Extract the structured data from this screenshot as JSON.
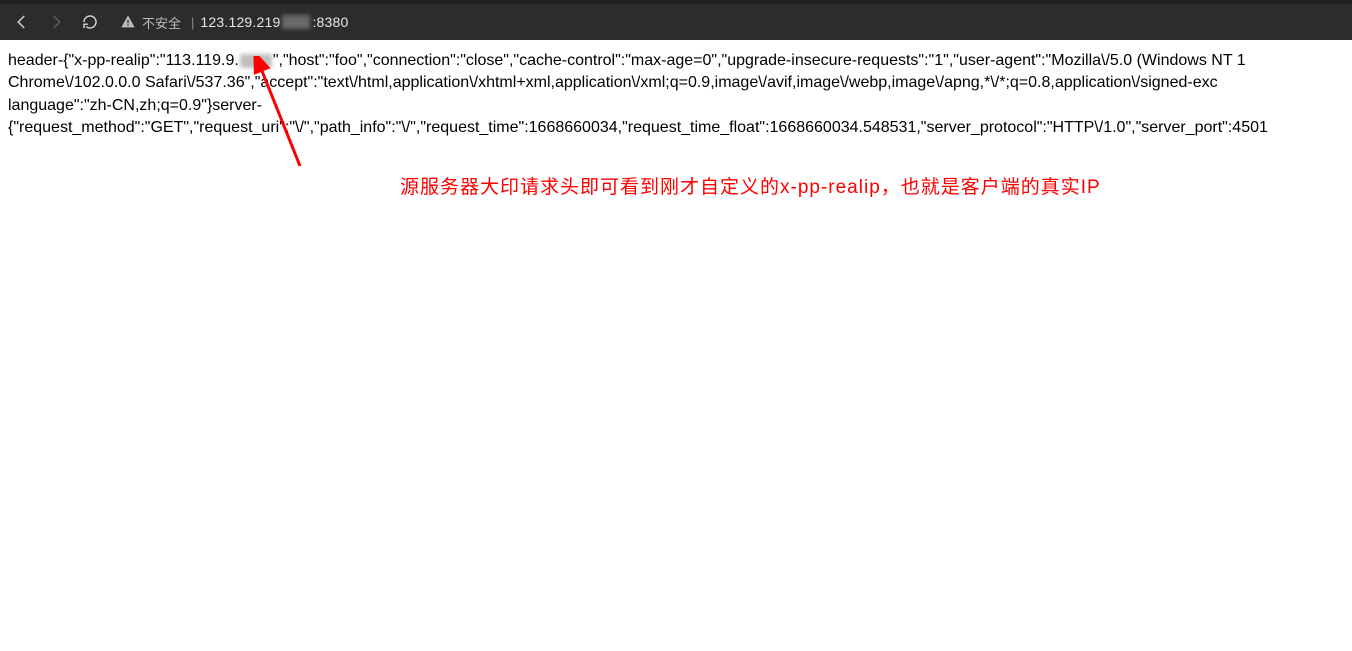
{
  "toolbar": {
    "insecure_label": "不安全",
    "url_prefix": "123.129.219",
    "url_suffix": ":8380"
  },
  "body": {
    "line1a": "header-{\"x-pp-realip\":\"113.119.9.",
    "line1b": "\",\"host\":\"foo\",\"connection\":\"close\",\"cache-control\":\"max-age=0\",\"upgrade-insecure-requests\":\"1\",\"user-agent\":\"Mozilla\\/5.0 (Windows NT 1",
    "line2": "Chrome\\/102.0.0.0 Safari\\/537.36\",\"accept\":\"text\\/html,application\\/xhtml+xml,application\\/xml;q=0.9,image\\/avif,image\\/webp,image\\/apng,*\\/*;q=0.8,application\\/signed-exc",
    "line3": "language\":\"zh-CN,zh;q=0.9\"}server-",
    "line4": "{\"request_method\":\"GET\",\"request_uri\":\"\\/\",\"path_info\":\"\\/\",\"request_time\":1668660034,\"request_time_float\":1668660034.548531,\"server_protocol\":\"HTTP\\/1.0\",\"server_port\":4501"
  },
  "annotation": {
    "text": "源服务器大印请求头即可看到刚才自定义的x-pp-realip，也就是客户端的真实IP"
  }
}
